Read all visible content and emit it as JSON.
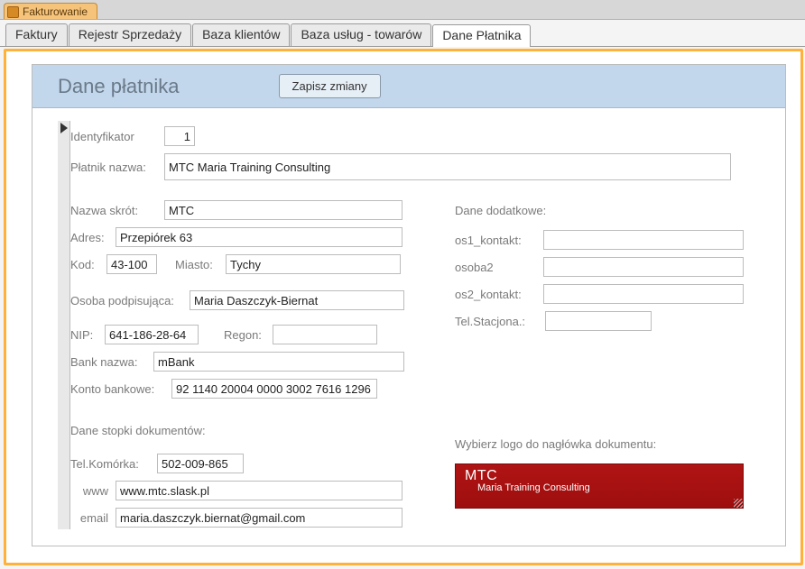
{
  "window": {
    "title": "Fakturowanie"
  },
  "tabs": [
    {
      "label": "Faktury",
      "active": false
    },
    {
      "label": "Rejestr Sprzedaży",
      "active": false
    },
    {
      "label": "Baza klientów",
      "active": false
    },
    {
      "label": "Baza usług - towarów",
      "active": false
    },
    {
      "label": "Dane Płatnika",
      "active": true
    }
  ],
  "header": {
    "title": "Dane płatnika",
    "save_label": "Zapisz zmiany"
  },
  "labels": {
    "id": "Identyfikator",
    "payer_name": "Płatnik nazwa:",
    "short_name": "Nazwa skrót:",
    "address": "Adres:",
    "postal": "Kod:",
    "city": "Miasto:",
    "signer": "Osoba podpisująca:",
    "nip": "NIP:",
    "regon": "Regon:",
    "bank_name": "Bank nazwa:",
    "account": "Konto bankowe:",
    "extra_section": "Dane dodatkowe:",
    "os1_contact": "os1_kontakt:",
    "person2": "osoba2",
    "os2_contact": "os2_kontakt:",
    "landline": "Tel.Stacjona.:",
    "footer_section": "Dane stopki dokumentów:",
    "mobile": "Tel.Komórka:",
    "www": "www",
    "email": "email",
    "choose_logo": "Wybierz logo do nagłówka dokumentu:"
  },
  "values": {
    "id": "1",
    "payer_name": "MTC Maria Training Consulting",
    "short_name": "MTC",
    "address": "Przepiórek 63",
    "postal": "43-100",
    "city": "Tychy",
    "signer": "Maria Daszczyk-Biernat",
    "nip": "641-186-28-64",
    "regon": "",
    "bank_name": "mBank",
    "account": "92 1140 20004 0000 3002 7616 1296",
    "os1_contact": "",
    "person2": "",
    "os2_contact": "",
    "landline": "",
    "mobile": "502-009-865",
    "www": "www.mtc.slask.pl",
    "email": "maria.daszczyk.biernat@gmail.com"
  },
  "logo": {
    "title": "MTC",
    "subtitle": "Maria Training Consulting"
  }
}
